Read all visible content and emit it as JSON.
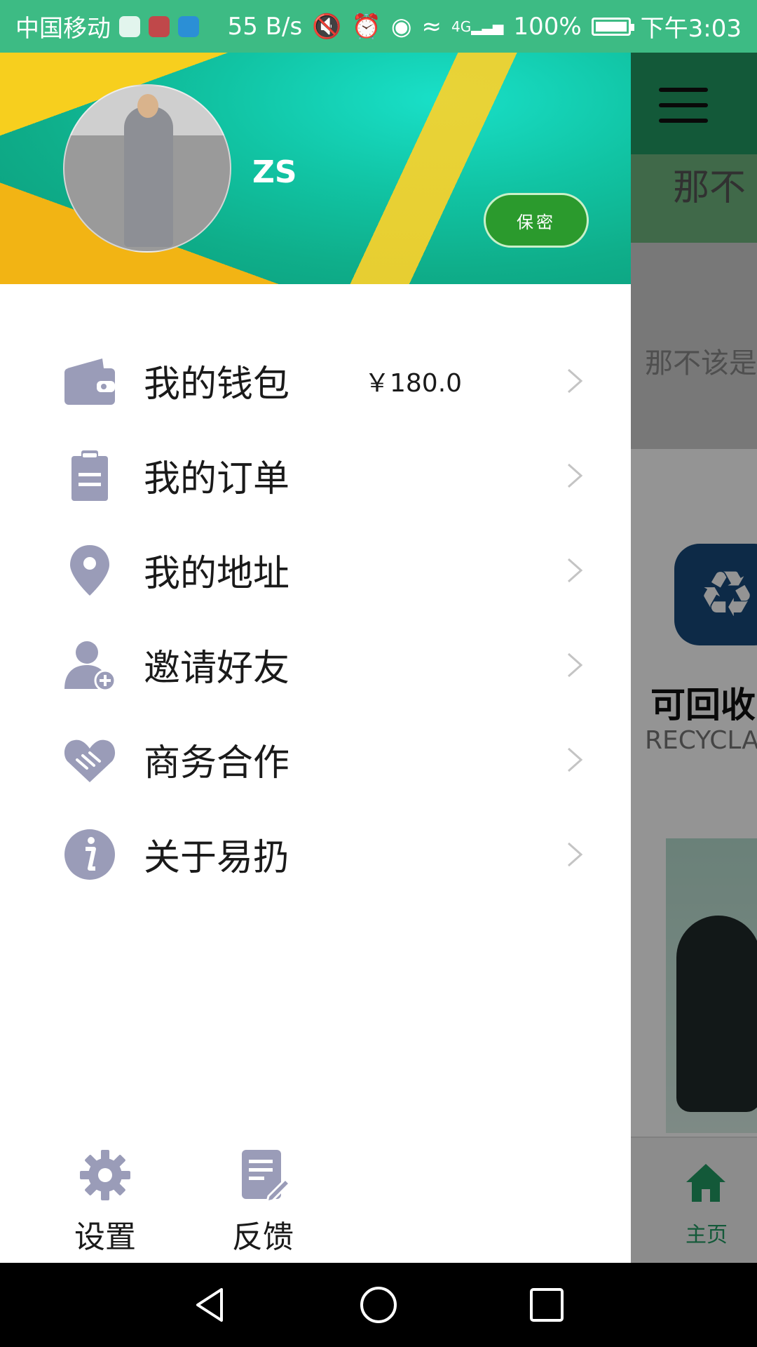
{
  "status_bar": {
    "carrier": "中国移动",
    "network_speed": "55 B/s",
    "network_type": "4G",
    "battery": "100%",
    "time": "下午3:03"
  },
  "drawer": {
    "username": "ZS",
    "privacy_button": "保密",
    "menu": [
      {
        "label": "我的钱包",
        "value": "￥180.0",
        "icon": "wallet-icon"
      },
      {
        "label": "我的订单",
        "value": "",
        "icon": "clipboard-icon"
      },
      {
        "label": "我的地址",
        "value": "",
        "icon": "location-pin-icon"
      },
      {
        "label": "邀请好友",
        "value": "",
        "icon": "add-user-icon"
      },
      {
        "label": "商务合作",
        "value": "",
        "icon": "handshake-icon"
      },
      {
        "label": "关于易扔",
        "value": "",
        "icon": "info-icon"
      }
    ],
    "bottom": {
      "settings_label": "设置",
      "feedback_label": "反馈"
    }
  },
  "background_page": {
    "banner_title": "那不",
    "banner_caption": "那不该是",
    "recycle_title": "可回收",
    "recycle_subtitle": "RECYCLA",
    "nav_home_label": "主页"
  },
  "colors": {
    "status_bar": "#3dbb84",
    "icon_gray": "#9a9cb8",
    "privacy_button": "#2b9a2d",
    "brand_green": "#229a63"
  }
}
